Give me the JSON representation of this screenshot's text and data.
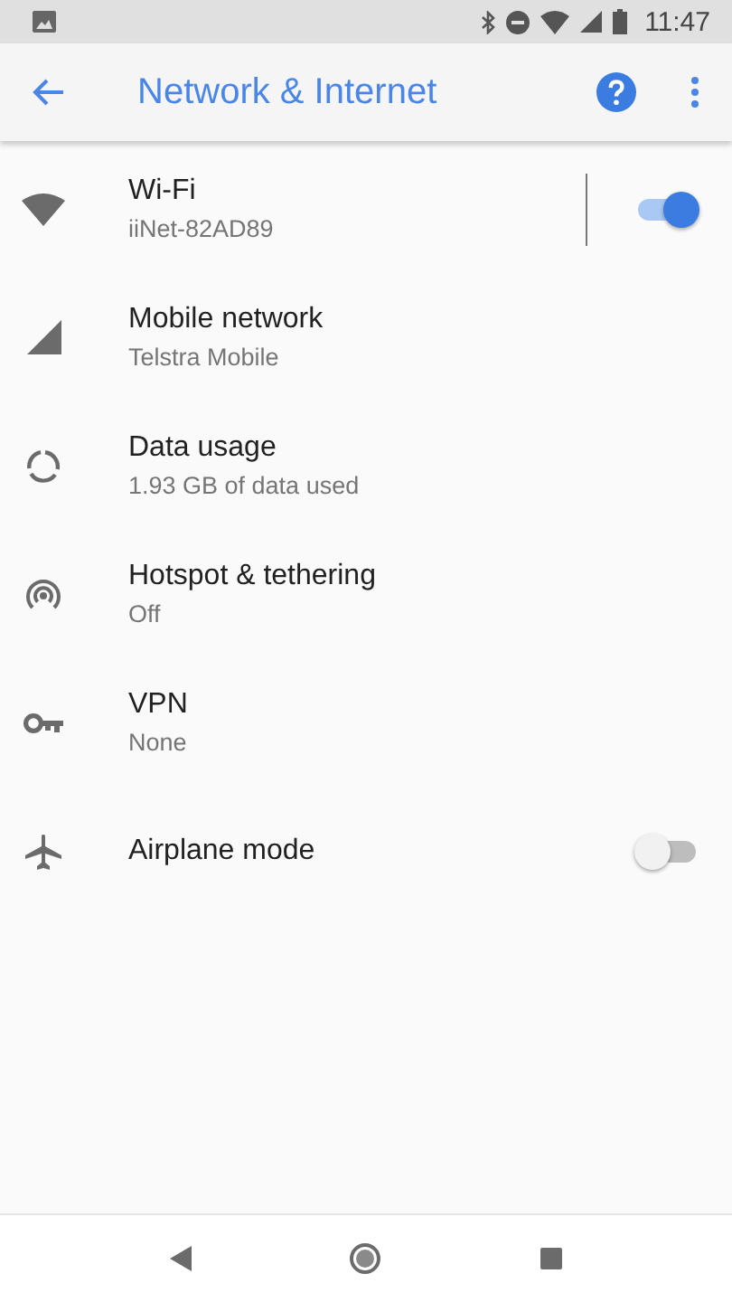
{
  "status_bar": {
    "time": "11:47"
  },
  "toolbar": {
    "title": "Network & Internet"
  },
  "items": [
    {
      "kind": "toggle",
      "title": "Wi-Fi",
      "summary": "iiNet-82AD89",
      "on": true
    },
    {
      "kind": "link",
      "title": "Mobile network",
      "summary": "Telstra Mobile"
    },
    {
      "kind": "link",
      "title": "Data usage",
      "summary": "1.93 GB of data used"
    },
    {
      "kind": "link",
      "title": "Hotspot & tethering",
      "summary": "Off"
    },
    {
      "kind": "link",
      "title": "VPN",
      "summary": "None"
    },
    {
      "kind": "toggle",
      "title": "Airplane mode",
      "on": false
    }
  ]
}
